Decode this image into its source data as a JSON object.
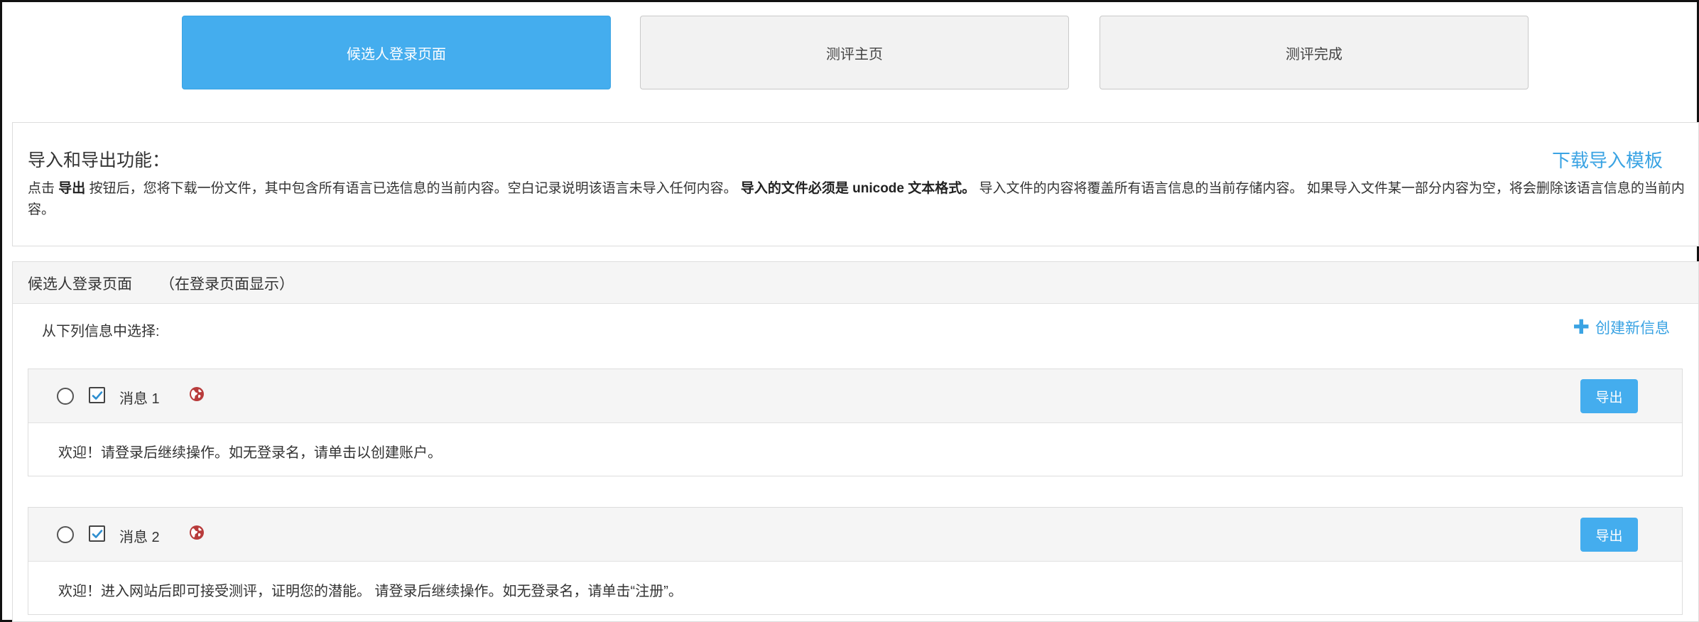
{
  "tabs": [
    {
      "label": "候选人登录页面",
      "active": true
    },
    {
      "label": "测评主页",
      "active": false
    },
    {
      "label": "测评完成",
      "active": false
    }
  ],
  "import_export": {
    "title": "导入和导出功能：",
    "download_template": "下载导入模板",
    "desc_1": "点击 ",
    "desc_bold_1": "导出",
    "desc_2": " 按钮后，您将下载一份文件，其中包含所有语言已选信息的当前内容。空白记录说明该语言未导入任何内容。 ",
    "desc_bold_2": "导入的文件必须是 unicode 文本格式。",
    "desc_3": " 导入文件的内容将覆盖所有语言信息的当前存储内容。 如果导入文件某一部分内容为空，将会删除该语言信息的当前内容。"
  },
  "section": {
    "title": "候选人登录页面",
    "subtitle": "（在登录页面显示）",
    "choose_label": "从下列信息中选择:",
    "create_new": "创建新信息",
    "messages": [
      {
        "label": "消息 1",
        "checked": true,
        "export_label": "导出",
        "body": "欢迎！请登录后继续操作。如无登录名，请单击以创建账户。"
      },
      {
        "label": "消息 2",
        "checked": true,
        "export_label": "导出",
        "body": "欢迎！进入网站后即可接受测评，证明您的潜能。 请登录后继续操作。如无登录名，请单击“注册”。"
      }
    ]
  },
  "colors": {
    "accent": "#44adee",
    "globe": "#b83b3b"
  },
  "icons": {
    "plus": "plus-icon",
    "globe": "globe-icon",
    "check": "check-icon"
  }
}
